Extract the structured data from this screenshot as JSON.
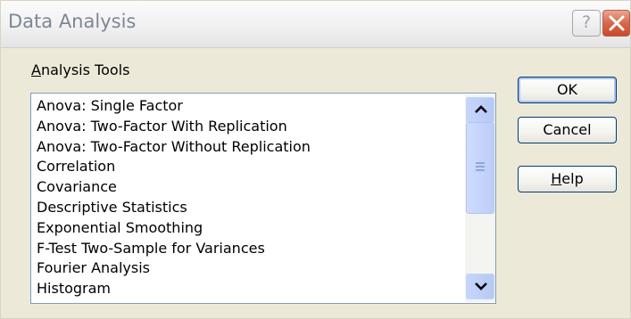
{
  "window": {
    "title": "Data Analysis",
    "help_icon": "question-icon",
    "close_icon": "close-icon",
    "colors": {
      "dialog_bg": "#ece9d8",
      "list_border": "#7f9db9",
      "scroll_accent": "#c6d6fb",
      "close_red": "#d7684a"
    }
  },
  "analysis_tools": {
    "label_accel": "A",
    "label_rest": "nalysis Tools",
    "items": [
      "Anova: Single Factor",
      "Anova: Two-Factor With Replication",
      "Anova: Two-Factor Without Replication",
      "Correlation",
      "Covariance",
      "Descriptive Statistics",
      "Exponential Smoothing",
      "F-Test Two-Sample for Variances",
      "Fourier Analysis",
      "Histogram"
    ],
    "scroll_up_icon": "chevron-up-icon",
    "scroll_down_icon": "chevron-down-icon"
  },
  "buttons": {
    "ok": "OK",
    "cancel": "Cancel",
    "help_accel": "H",
    "help_rest": "elp"
  }
}
